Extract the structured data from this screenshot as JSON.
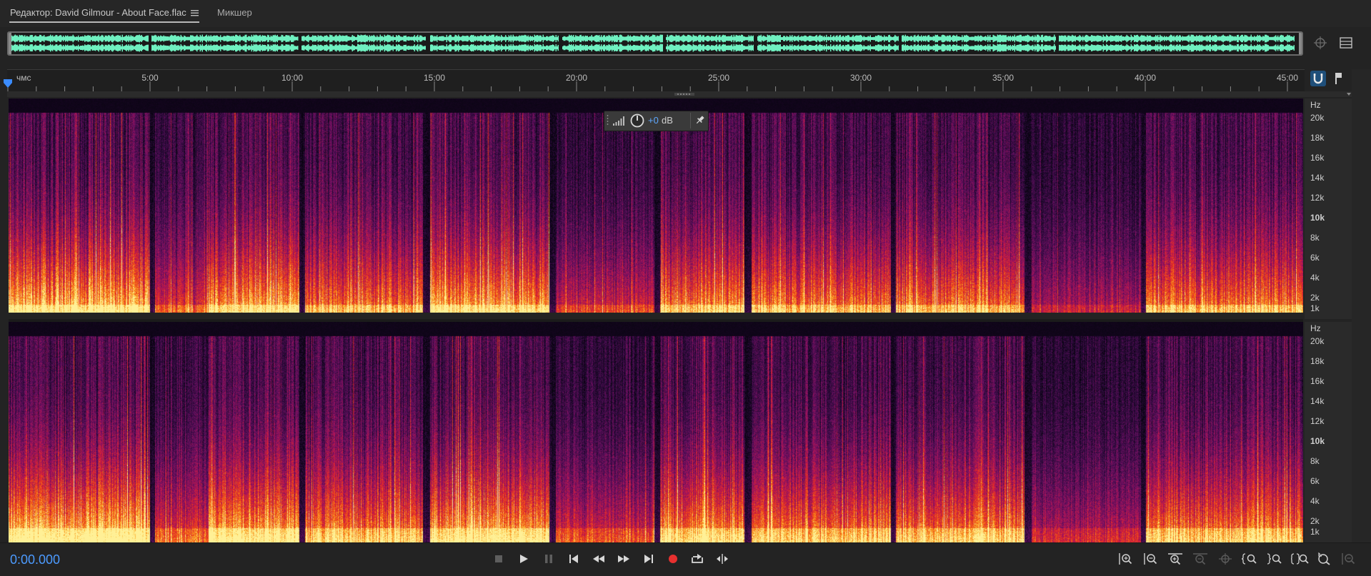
{
  "tabs": {
    "editor_label": "Редактор: David Gilmour - About Face.flac",
    "mixer_label": "Микшер"
  },
  "ruler": {
    "unit_label": "чмс",
    "ticks": [
      "5:00",
      "10:00",
      "15:00",
      "20:00",
      "25:00",
      "30:00",
      "35:00",
      "40:00",
      "45:00"
    ]
  },
  "hud": {
    "value": "+0",
    "unit": "dB"
  },
  "channels": [
    {
      "unit": "Hz",
      "labels": [
        "20k",
        "18k",
        "16k",
        "14k",
        "12k",
        "10k",
        "8k",
        "6k",
        "4k",
        "2k",
        "1k"
      ]
    },
    {
      "unit": "Hz",
      "labels": [
        "20k",
        "18k",
        "16k",
        "14k",
        "12k",
        "10k",
        "8k",
        "6k",
        "4k",
        "2k",
        "1k"
      ]
    }
  ],
  "transport": {
    "time": "0:00.000"
  },
  "icons": {
    "transport": [
      "stop-icon",
      "play-icon",
      "pause-icon",
      "skip-to-start-icon",
      "rewind-icon",
      "fast-forward-icon",
      "skip-to-end-icon",
      "record-icon",
      "loop-icon",
      "skip-selection-icon"
    ],
    "zoom": [
      "zoom-in-amplitude-icon",
      "zoom-out-amplitude-icon",
      "zoom-in-time-icon",
      "zoom-out-time-icon",
      "zoom-selection-icon",
      "zoom-in-left-icon",
      "zoom-in-right-icon",
      "zoom-full-icon",
      "zoom-reset-icon",
      "zoom-out-full-icon"
    ]
  },
  "colors": {
    "accent": "#4c9bff",
    "waveform": "#6ff0c0",
    "record": "#e8302f"
  }
}
